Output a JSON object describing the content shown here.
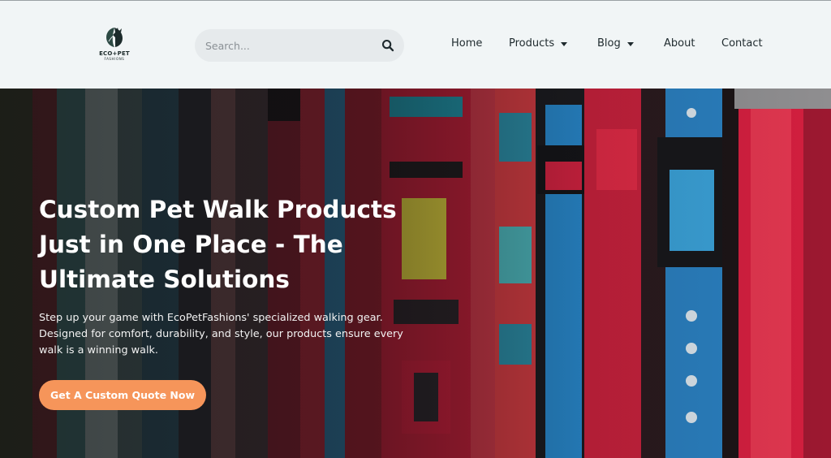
{
  "brand": {
    "logo_name": "ECO",
    "logo_plus": "+",
    "logo_name_2": "PET",
    "logo_sub": "FASHIONS"
  },
  "search": {
    "placeholder": "Search...",
    "icon": "search-icon"
  },
  "nav": {
    "items": [
      {
        "label": "Home",
        "has_dropdown": false
      },
      {
        "label": "Products",
        "has_dropdown": true
      },
      {
        "label": "Blog",
        "has_dropdown": true
      },
      {
        "label": "About",
        "has_dropdown": false
      },
      {
        "label": "Contact",
        "has_dropdown": false
      }
    ]
  },
  "hero": {
    "title": "Custom Pet Walk Products Just in One Place - The Ultimate Solutions",
    "text": "Step up your game with EcoPetFashions' specialized walking gear. Designed for comfort, durability, and style, our products ensure every walk is a winning walk.",
    "cta_label": "Get A Custom Quote Now"
  },
  "colors": {
    "header_bg": "#f1f5f6",
    "cta": "#f6955a",
    "text_dark": "#1f2a2e"
  }
}
